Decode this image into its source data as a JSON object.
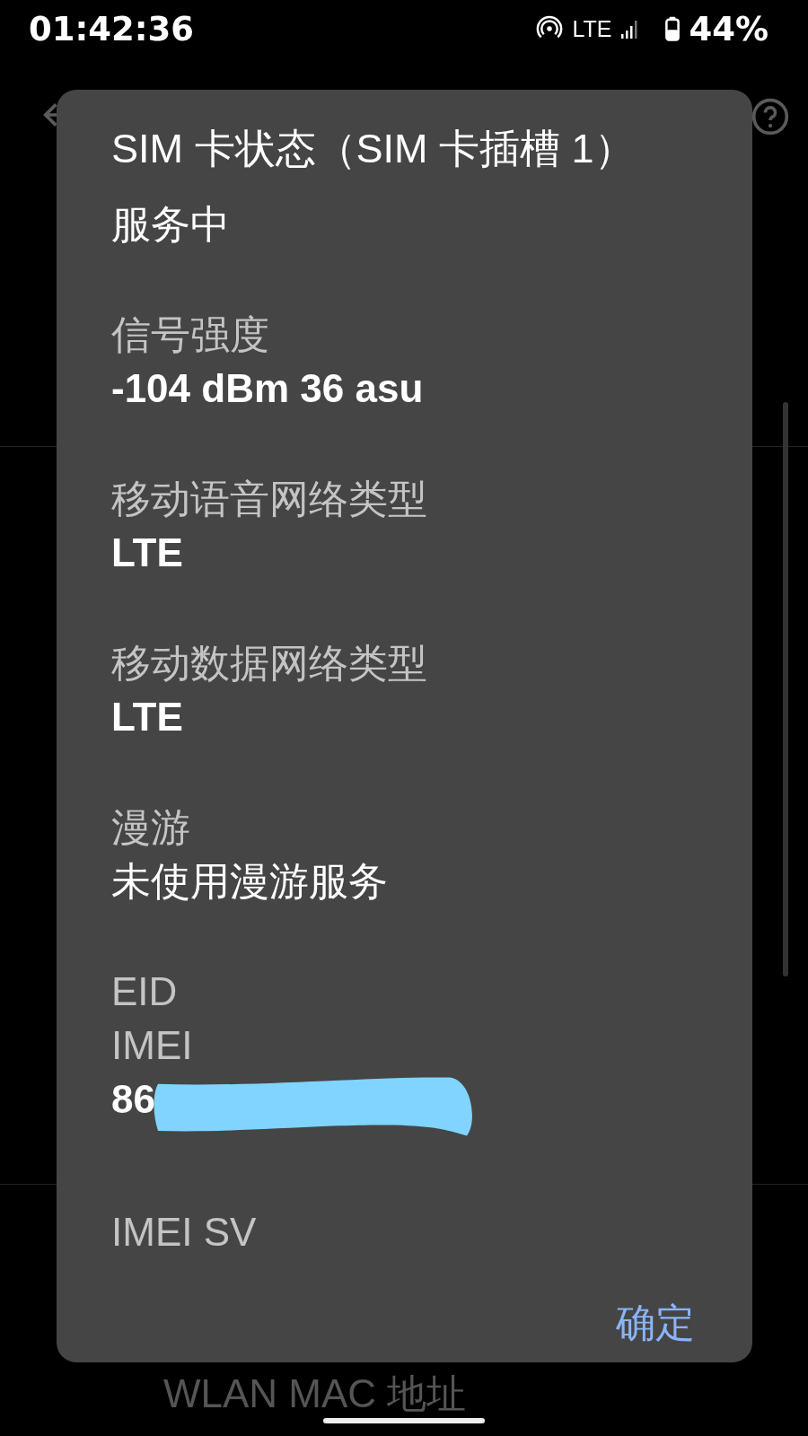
{
  "status_bar": {
    "time": "01:42:36",
    "network": "LTE",
    "battery": "44%"
  },
  "background": {
    "bottom_item": "WLAN MAC 地址"
  },
  "dialog": {
    "title": "SIM 卡状态（SIM 卡插槽 1）",
    "status": "服务中",
    "items": [
      {
        "label": "信号强度",
        "value": "-104 dBm 36 asu"
      },
      {
        "label": "移动语音网络类型",
        "value": "LTE"
      },
      {
        "label": "移动数据网络类型",
        "value": "LTE"
      },
      {
        "label": "漫游",
        "value": "未使用漫游服务",
        "kind": "plain"
      },
      {
        "label": "EID"
      },
      {
        "label": "IMEI",
        "value": "86",
        "redacted": true
      },
      {
        "label": "IMEI SV"
      }
    ],
    "button": "确定"
  }
}
